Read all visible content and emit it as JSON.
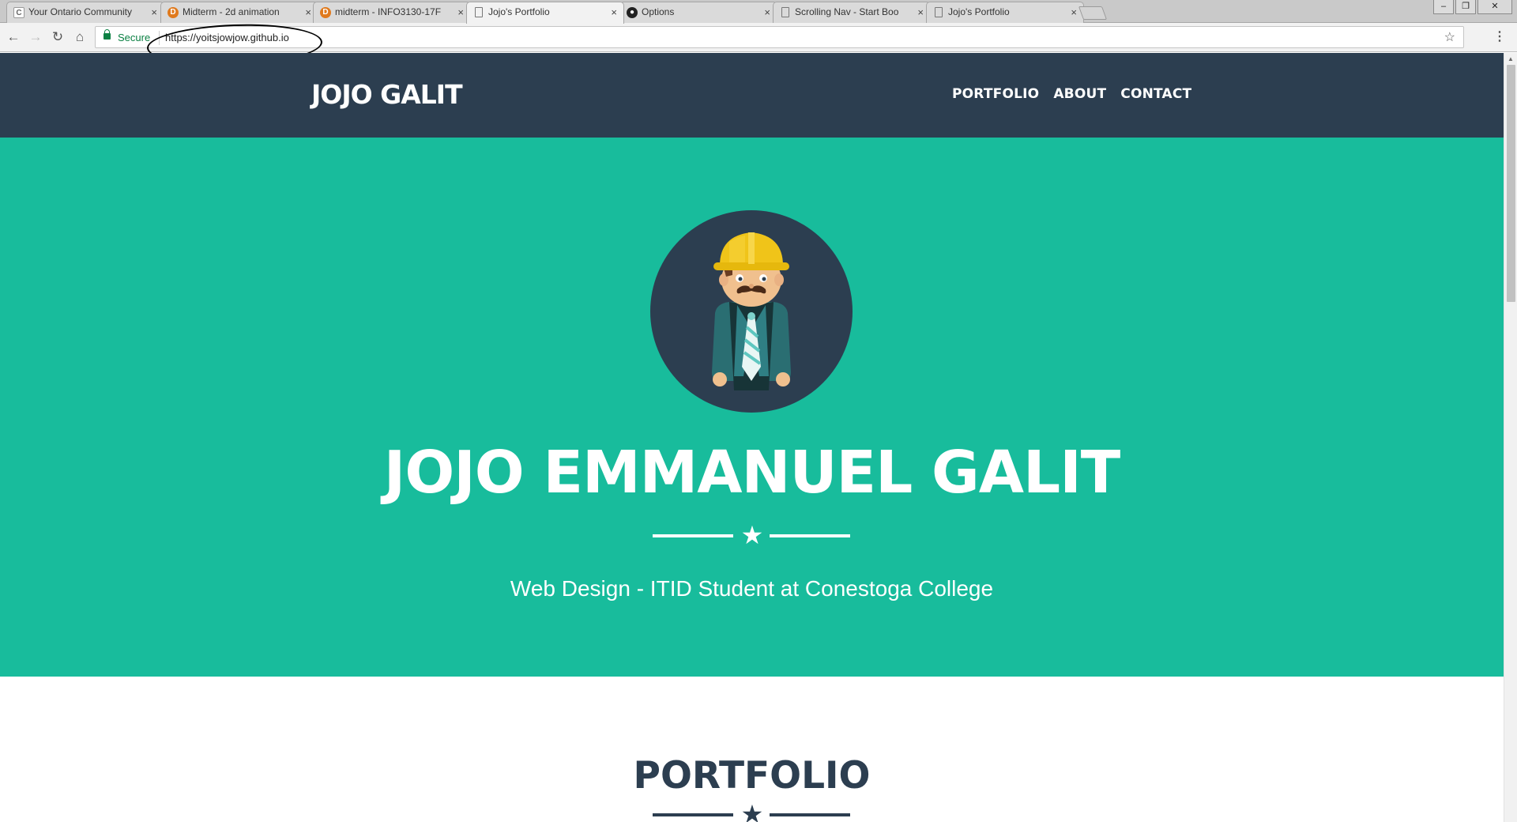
{
  "browser": {
    "tabs": [
      {
        "title": "Your Ontario Community",
        "favicon": "c-icon",
        "active": false
      },
      {
        "title": "Midterm - 2d animation",
        "favicon": "d2l-icon",
        "active": false
      },
      {
        "title": "midterm - INFO3130-17F",
        "favicon": "d2l-icon",
        "active": false
      },
      {
        "title": "Jojo's Portfolio",
        "favicon": "page-icon",
        "active": true
      },
      {
        "title": "Options",
        "favicon": "github-icon",
        "active": false
      },
      {
        "title": "Scrolling Nav - Start Boo",
        "favicon": "page-icon",
        "active": false
      },
      {
        "title": "Jojo's Portfolio",
        "favicon": "page-icon",
        "active": false
      }
    ],
    "close_glyph": "×",
    "security_label": "Secure",
    "url": "https://yoitsjowjow.github.io",
    "window_controls": {
      "minimize": "–",
      "restore": "❐",
      "close": "✕"
    }
  },
  "site": {
    "brand": "JOJO GALIT",
    "nav": [
      "PORTFOLIO",
      "ABOUT",
      "CONTACT"
    ],
    "hero": {
      "title": "JOJO EMMANUEL GALIT",
      "subtitle": "Web Design - ITID Student at Conestoga College",
      "star_glyph": "★"
    },
    "sections": {
      "portfolio_title": "PORTFOLIO"
    }
  },
  "colors": {
    "navbar_bg": "#2c3e50",
    "hero_bg": "#18bc9c",
    "accent_text": "#ffffff",
    "section_heading": "#2c3e50"
  }
}
